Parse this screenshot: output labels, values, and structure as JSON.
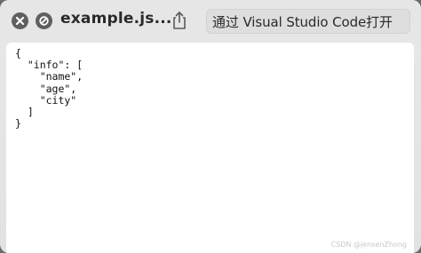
{
  "window": {
    "title": "example.js...",
    "open_button_label": "通过 Visual Studio Code打开"
  },
  "content": {
    "json_lines": [
      "{",
      "  \"info\": [",
      "    \"name\",",
      "    \"age\",",
      "    \"city\"",
      "  ]",
      "}"
    ]
  },
  "watermark": "CSDN @jensenZhong",
  "icons": {
    "close": "close-icon",
    "stop": "stop-icon",
    "share": "share-icon"
  },
  "colors": {
    "titlebar": "#e6e6e6",
    "content_bg": "#ffffff",
    "icon_fill": "#5f5f5f",
    "text": "#2a2a2a"
  }
}
